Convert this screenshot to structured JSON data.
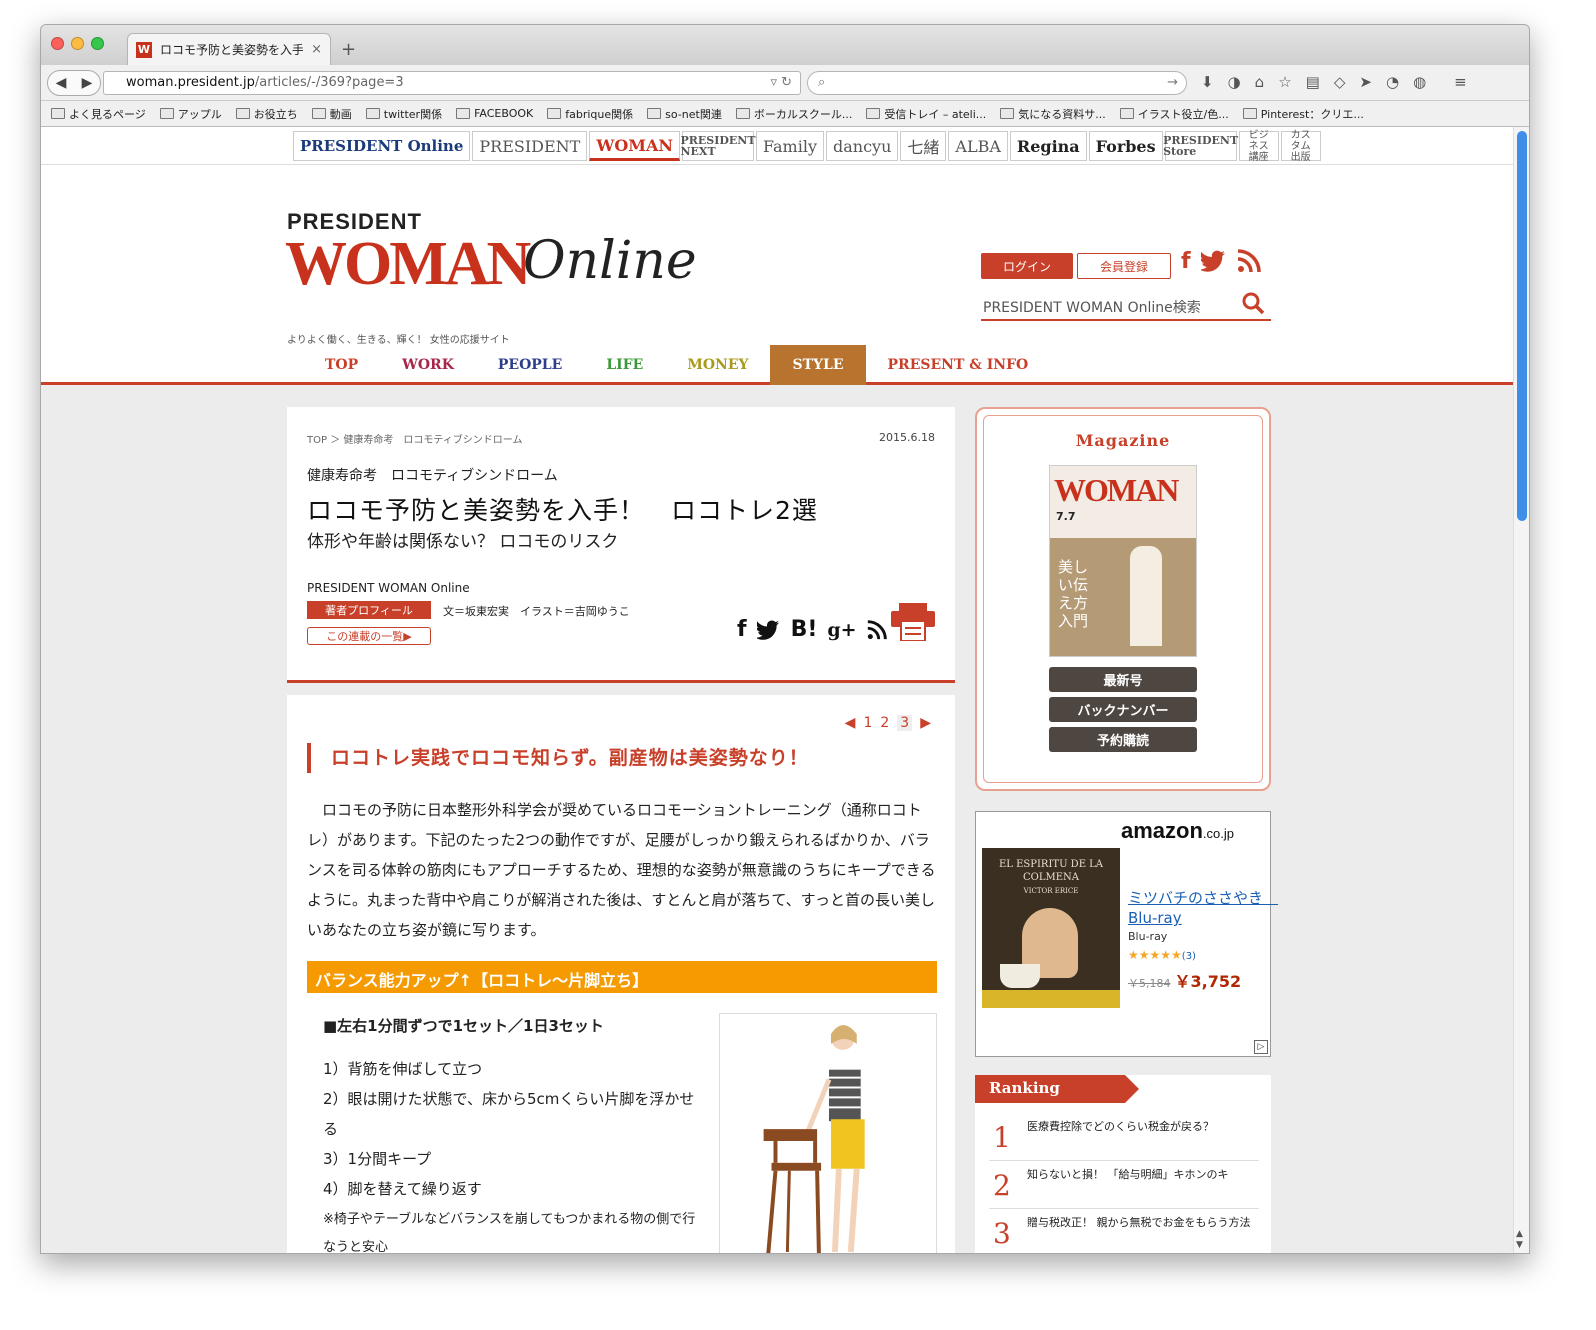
{
  "browser": {
    "tab_title": "ロコモ予防と美姿勢を入手...",
    "tab_close": "×",
    "new_tab": "+",
    "url_host": "woman.president.jp",
    "url_path": "/articles/-/369?page=3",
    "bookmarks": [
      "よく見るページ",
      "アップル",
      "お役立ち",
      "動画",
      "twitter関係",
      "FACEBOOK",
      "fabrique関係",
      "so-net関連",
      "ボーカルスクール...",
      "受信トレイ – ateli...",
      "気になる資料サ...",
      "イラスト役立/色...",
      "Pinterest：クリエ..."
    ]
  },
  "brands": [
    "PRESIDENT Online",
    "PRESIDENT",
    "WOMAN",
    "PRESIDENT NEXT",
    "Family",
    "dancyu",
    "七緒",
    "ALBA",
    "Regina",
    "Forbes",
    "PRESIDENT Store",
    "ビジネス講座",
    "カスタム出版"
  ],
  "header": {
    "logo_top": "PRESIDENT",
    "logo_woman": "WOMAN",
    "logo_online": "Online",
    "tagline": "よりよく働く、生きる、輝く！ 女性の応援サイト",
    "login": "ログイン",
    "register": "会員登録",
    "search_placeholder": "PRESIDENT WOMAN Online検索"
  },
  "nav": [
    {
      "label": "TOP",
      "color": "#c8402a"
    },
    {
      "label": "WORK",
      "color": "#a8264a"
    },
    {
      "label": "PEOPLE",
      "color": "#2c3e8a"
    },
    {
      "label": "LIFE",
      "color": "#3a9a3a"
    },
    {
      "label": "MONEY",
      "color": "#a89a1a"
    },
    {
      "label": "STYLE",
      "color": "#ffffff",
      "active_bg": "#b8732e"
    },
    {
      "label": "PRESENT & INFO",
      "color": "#c8402a"
    }
  ],
  "article": {
    "breadcrumb": "TOP ＞ 健康寿命考　ロコモティブシンドローム",
    "date": "2015.6.18",
    "series": "健康寿命考　ロコモティブシンドローム",
    "title": "ロコモ予防と美姿勢を入手！　ロコトレ2選",
    "subtitle": "体形や年齢は関係ない？ ロコモのリスク",
    "publisher": "PRESIDENT WOMAN Online",
    "profile_btn": "著者プロフィール",
    "credit": "文＝坂東宏実　イラスト＝吉岡ゆうこ",
    "series_list_btn": "この連載の一覧▶",
    "share_hatena": "B!",
    "share_gplus": "g+"
  },
  "pager": {
    "prev": "◀",
    "pages": [
      "1",
      "2",
      "3"
    ],
    "current": "3",
    "next": "▶"
  },
  "content": {
    "heading": "ロコトレ実践でロコモ知らず。副産物は美姿勢なり！",
    "paragraph": "ロコモの予防に日本整形外科学会が奨めているロコモーショントレーニング（通称ロコトレ）があります。下記のたった2つの動作ですが、足腰がしっかり鍛えられるばかりか、バランスを司る体幹の筋肉にもアプローチするため、理想的な姿勢が無意識のうちにキープできるように。丸まった背中や肩こりが解消された後は、すとんと肩が落ちて、すっと首の長い美しいあなたの立ち姿が鏡に写ります。",
    "section_title": "バランス能力アップ↑【ロコトレ〜片脚立ち】",
    "set_info": "■左右1分間ずつで1セット／1日3セット",
    "steps": [
      "1）背筋を伸ばして立つ",
      "2）眼は開けた状態で、床から5cmくらい片脚を浮かせる",
      "3）1分間キープ",
      "4）脚を替えて繰り返す"
    ],
    "note": "※椅子やテーブルなどバランスを崩してもつかまれる物の側で行なうと安心"
  },
  "magazine": {
    "title": "Magazine",
    "cover_brand": "WOMAN",
    "cover_issue": "7.7",
    "cover_headline": "美しい伝え方入門",
    "buttons": [
      "最新号",
      "バックナンバー",
      "予約購読"
    ]
  },
  "ad": {
    "logo": "amazon",
    "logo_tld": ".co.jp",
    "film_title": "EL ESPIRITU DE LA COLMENA",
    "film_director": "VICTOR ERICE",
    "product": "ミツバチのささやき　Blu-ray",
    "format": "Blu-ray",
    "stars": "★★★★★",
    "reviews": "(3)",
    "list_price": "￥5,184",
    "price": "￥3,752",
    "choice": "▷"
  },
  "ranking": {
    "title": "Ranking",
    "items": [
      {
        "rank": "1",
        "text": "医療費控除でどのくらい税金が戻る？"
      },
      {
        "rank": "2",
        "text": "知らないと損！ 「給与明細」キホンのキ"
      },
      {
        "rank": "3",
        "text": "贈与税改正！ 親から無税でお金をもらう方法"
      }
    ]
  },
  "colors": {
    "accent": "#c8402a",
    "style_tab": "#b8732e",
    "section_bar": "#f59a00"
  }
}
